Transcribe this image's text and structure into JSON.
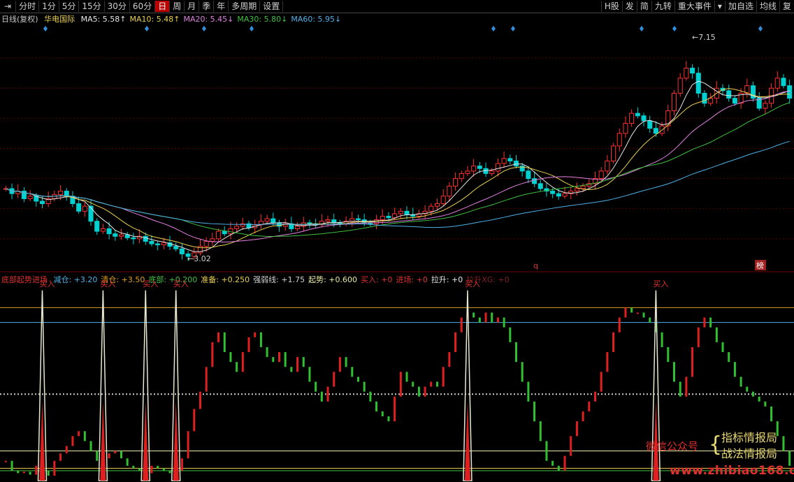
{
  "toolbar": {
    "left_icon": "⇥",
    "items": [
      "分时",
      "1分",
      "5分",
      "15分",
      "30分",
      "60分",
      "日",
      "周",
      "月",
      "季",
      "年",
      "多周期",
      "设置"
    ],
    "active_index": 6,
    "right_items": [
      "H股",
      "发",
      "简",
      "九转",
      "重大事件",
      "▾",
      "加自选",
      "均线",
      "复"
    ]
  },
  "price_legend": {
    "period": "日线(复权)",
    "stock": "华电国际",
    "ma": [
      {
        "label": "MA5: 5.58↑",
        "color": "#e8e8e8"
      },
      {
        "label": "MA10: 5.48↑",
        "color": "#e8d050"
      },
      {
        "label": "MA20: 5.45↓",
        "color": "#e080e0"
      },
      {
        "label": "MA30: 5.80↓",
        "color": "#40c040"
      },
      {
        "label": "MA60: 5.95↓",
        "color": "#50b0e8"
      }
    ]
  },
  "indicator_legend": {
    "name": "底部起势进场",
    "items": [
      {
        "label": "减仓: +3.20",
        "color": "#50b0e8"
      },
      {
        "label": "清仓: +3.50",
        "color": "#e0a020"
      },
      {
        "label": "底部: +0.200",
        "color": "#40c040"
      },
      {
        "label": "准备: +0.250",
        "color": "#e8d050"
      },
      {
        "label": "强弱线: +1.75",
        "color": "#d0d0d0"
      },
      {
        "label": "起势: +0.600",
        "color": "#e8e8a0"
      },
      {
        "label": "买入: +0",
        "color": "#e03030"
      },
      {
        "label": "进场: +0",
        "color": "#e03030"
      },
      {
        "label": "拉升: +0",
        "color": "#e8e8e8"
      },
      {
        "label": "拉升XG: +0",
        "color": "#802020"
      }
    ]
  },
  "annotations": {
    "high_label": "7.15",
    "low_label": "3.02",
    "buy_label": "买入",
    "q_label": "q",
    "bang_label": "榜"
  },
  "watermark": {
    "wechat": "微信公众号",
    "line1": "指标情报局",
    "line2": "战法情报局",
    "site": "www.zhibiao168.com"
  },
  "chart_data": [
    {
      "type": "line",
      "title": "",
      "subtitle": "",
      "xlabel": "",
      "ylabel": "",
      "series_names": [],
      "n_bars": 130,
      "ylim": [
        2.8,
        7.6
      ],
      "close": [
        4.4,
        4.3,
        4.35,
        4.2,
        4.25,
        4.15,
        4.1,
        4.2,
        4.28,
        4.35,
        4.25,
        4.1,
        3.95,
        4.05,
        3.75,
        3.55,
        3.6,
        3.5,
        3.45,
        3.48,
        3.42,
        3.4,
        3.45,
        3.35,
        3.3,
        3.28,
        3.32,
        3.25,
        3.2,
        3.1,
        3.05,
        3.12,
        3.25,
        3.35,
        3.4,
        3.55,
        3.5,
        3.6,
        3.65,
        3.7,
        3.62,
        3.68,
        3.75,
        3.8,
        3.72,
        3.65,
        3.7,
        3.6,
        3.65,
        3.72,
        3.7,
        3.68,
        3.75,
        3.78,
        3.72,
        3.7,
        3.75,
        3.8,
        3.78,
        3.72,
        3.7,
        3.78,
        3.85,
        3.82,
        3.9,
        3.95,
        3.88,
        3.85,
        3.9,
        3.95,
        4.05,
        4.1,
        4.25,
        4.45,
        4.6,
        4.7,
        4.75,
        4.85,
        4.8,
        4.7,
        4.75,
        4.9,
        5.0,
        4.95,
        4.85,
        4.75,
        4.6,
        4.5,
        4.4,
        4.35,
        4.3,
        4.25,
        4.3,
        4.35,
        4.4,
        4.45,
        4.5,
        4.6,
        4.75,
        4.95,
        5.25,
        5.5,
        5.7,
        5.9,
        5.85,
        5.75,
        5.6,
        5.5,
        5.65,
        5.95,
        6.3,
        6.6,
        6.8,
        6.7,
        6.3,
        6.1,
        6.2,
        6.4,
        6.35,
        6.2,
        6.1,
        6.3,
        6.45,
        6.2,
        6.0,
        6.1,
        6.4,
        6.6,
        6.45,
        6.2
      ]
    },
    {
      "type": "bar",
      "title": "",
      "subtitle": "",
      "xlabel": "",
      "ylabel": "",
      "series_names": [],
      "ylim": [
        0,
        4
      ],
      "levels": {
        "减仓": 3.2,
        "清仓": 3.5,
        "底部": 0.2,
        "准备": 0.25,
        "强弱线": 1.75,
        "起势": 0.6
      },
      "values": [
        0.4,
        0.2,
        0.15,
        0.18,
        0.12,
        0.3,
        0.2,
        0.1,
        0.4,
        0.55,
        0.7,
        0.9,
        1.0,
        0.8,
        0.6,
        0.4,
        0.45,
        0.55,
        0.6,
        0.45,
        0.3,
        0.25,
        0.2,
        0.15,
        0.3,
        0.25,
        0.2,
        0.15,
        0.2,
        0.45,
        1.0,
        1.45,
        1.8,
        2.3,
        2.8,
        3.0,
        2.6,
        2.4,
        2.2,
        2.6,
        2.9,
        3.0,
        2.7,
        2.5,
        2.4,
        2.6,
        2.3,
        2.2,
        2.5,
        2.3,
        2.0,
        1.8,
        1.6,
        1.9,
        2.2,
        2.5,
        2.3,
        2.1,
        2.0,
        1.8,
        1.6,
        1.4,
        1.3,
        1.2,
        1.7,
        2.2,
        2.0,
        1.9,
        1.7,
        1.9,
        2.0,
        1.9,
        2.3,
        2.6,
        3.0,
        3.3,
        3.4,
        3.3,
        3.2,
        3.4,
        3.2,
        3.3,
        3.1,
        2.8,
        2.4,
        2.0,
        1.6,
        1.2,
        0.8,
        0.4,
        0.3,
        0.2,
        0.5,
        0.9,
        1.2,
        1.4,
        1.6,
        1.8,
        2.2,
        2.6,
        3.0,
        3.3,
        3.5,
        3.4,
        3.4,
        3.3,
        3.2,
        3.0,
        2.7,
        2.4,
        2.0,
        1.7,
        2.1,
        2.7,
        3.1,
        3.3,
        3.1,
        2.8,
        2.6,
        2.4,
        2.1,
        1.9,
        1.8,
        1.7,
        1.6,
        1.5,
        1.2,
        0.9,
        0.6,
        0.3
      ],
      "buy_signals": [
        6,
        16,
        23,
        28,
        76,
        107
      ]
    }
  ]
}
